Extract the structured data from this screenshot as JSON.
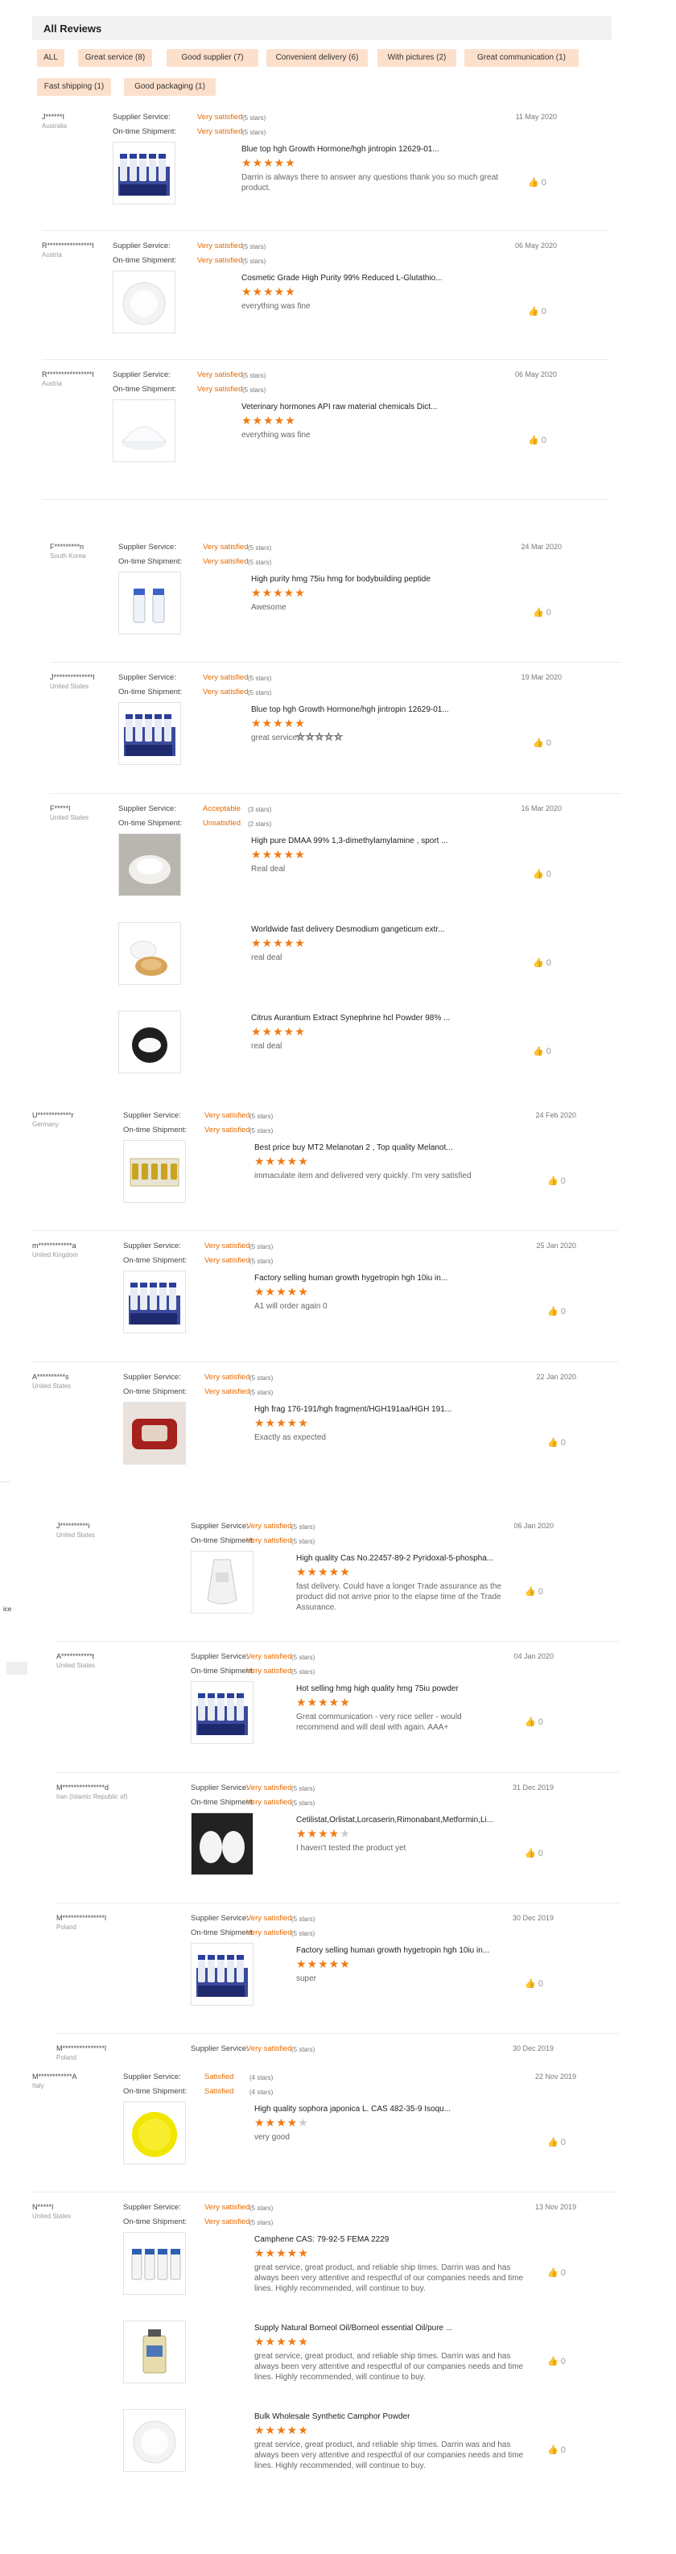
{
  "header": {
    "title": "All Reviews"
  },
  "tabs": [
    {
      "label": "ALL"
    },
    {
      "label": "Great service (8)"
    },
    {
      "label": "Good supplier (7)"
    },
    {
      "label": "Convenient delivery (6)"
    },
    {
      "label": "With pictures (2)"
    },
    {
      "label": "Great communication (1)"
    },
    {
      "label": "Fast shipping (1)"
    },
    {
      "label": "Good packaging (1)"
    }
  ],
  "labels": {
    "supplier_service": "Supplier Service:",
    "on_time_shipment": "On-time Shipment:"
  },
  "sections": [
    {
      "reviews": [
        {
          "name": "J******I",
          "country": "Australia",
          "date": "11 May 2020",
          "supplier": "Very satisfied",
          "supplier_stars": "(5 stars)",
          "shipment": "Very satisfied",
          "shipment_stars": "(5 stars)",
          "products": [
            {
              "title": "Blue top hgh Growth Hormone/hgh jintropin 12629-01...",
              "stars": 5,
              "comment": "Darrin is always there to answer any questions thank you so much great product.",
              "likes": "0",
              "img": "vials-blue"
            }
          ]
        },
        {
          "name": "R****************l",
          "country": "Austria",
          "date": "06 May 2020",
          "supplier": "Very satisfied",
          "supplier_stars": "(5 stars)",
          "shipment": "Very satisfied",
          "shipment_stars": "(5 stars)",
          "products": [
            {
              "title": "Cosmetic Grade High Purity 99% Reduced L-Glutathio...",
              "stars": 5,
              "comment": "everything was fine",
              "likes": "0",
              "img": "powder-dish"
            }
          ]
        },
        {
          "name": "R****************l",
          "country": "Austria",
          "date": "06 May 2020",
          "supplier": "Very satisfied",
          "supplier_stars": "(5 stars)",
          "shipment": "Very satisfied",
          "shipment_stars": "(5 stars)",
          "products": [
            {
              "title": "Veterinary hormones API raw material chemicals Dict...",
              "stars": 5,
              "comment": "everything was fine",
              "likes": "0",
              "img": "powder-pile"
            }
          ]
        }
      ]
    },
    {
      "reviews": [
        {
          "name": "F*********n",
          "country": "South Korea",
          "date": "24 Mar 2020",
          "supplier": "Very satisfied",
          "supplier_stars": "(5 stars)",
          "shipment": "Very satisfied",
          "shipment_stars": "(5 stars)",
          "products": [
            {
              "title": "High purity hmg 75iu hmg for bodybuilding peptide",
              "stars": 5,
              "comment": "Awesome",
              "likes": "0",
              "img": "two-vials"
            }
          ]
        },
        {
          "name": "J**************l",
          "country": "United States",
          "date": "19 Mar 2020",
          "supplier": "Very satisfied",
          "supplier_stars": "(5 stars)",
          "shipment": "Very satisfied",
          "shipment_stars": "(5 stars)",
          "products": [
            {
              "title": "Blue top hgh Growth Hormone/hgh jintropin 12629-01...",
              "stars": 5,
              "comment": "great service",
              "extra_rating": "☆☆☆☆☆",
              "likes": "0",
              "img": "vials-blue"
            }
          ]
        },
        {
          "name": "F*****I",
          "country": "United States",
          "date": "16 Mar 2020",
          "supplier": "Acceptable",
          "supplier_stars": "(3 stars)",
          "shipment": "Unsatisfied",
          "shipment_stars": "(2 stars)",
          "products": [
            {
              "title": "High pure DMAA 99% 1,3-dimethylamylamine , sport ...",
              "stars": 5,
              "comment": "Real deal",
              "likes": "0",
              "img": "powder-photo"
            },
            {
              "title": "Worldwide fast delivery Desmodium gangeticum extr...",
              "stars": 5,
              "comment": "real deal",
              "likes": "0",
              "img": "herb-powder"
            },
            {
              "title": "Citrus Aurantium Extract Synephrine hcl Powder 98% ...",
              "stars": 5,
              "comment": "real deal",
              "likes": "0",
              "img": "powder-dark"
            }
          ]
        }
      ]
    },
    {
      "reviews": [
        {
          "name": "U************r",
          "country": "Germany",
          "date": "24 Feb 2020",
          "supplier": "Very satisfied",
          "supplier_stars": "(5 stars)",
          "shipment": "Very satisfied",
          "shipment_stars": "(5 stars)",
          "products": [
            {
              "title": "Best price buy MT2 Melanotan 2 , Top quality Melanot...",
              "stars": 5,
              "comment": "immaculate item and delivered very quickly. I'm very satisfied",
              "likes": "0",
              "img": "vials-gold"
            }
          ]
        },
        {
          "name": "m************a",
          "country": "United Kingdom",
          "date": "25 Jan 2020",
          "supplier": "Very satisfied",
          "supplier_stars": "(5 stars)",
          "shipment": "Very satisfied",
          "shipment_stars": "(5 stars)",
          "products": [
            {
              "title": "Factory selling human growth hygetropin hgh 10iu in...",
              "stars": 5,
              "comment": "A1 will order again 0",
              "likes": "0",
              "img": "vials-blue"
            }
          ]
        },
        {
          "name": "A**********s",
          "country": "United States",
          "date": "22 Jan 2020",
          "supplier": "Very satisfied",
          "supplier_stars": "(5 stars)",
          "shipment": "Very satisfied",
          "shipment_stars": "(5 stars)",
          "products": [
            {
              "title": "Hgh frag 176-191/hgh fragment/HGH191aa/HGH 191...",
              "stars": 5,
              "comment": "Exactly as expected",
              "likes": "0",
              "img": "red-box"
            }
          ]
        }
      ]
    },
    {
      "reviews": [
        {
          "name": "J**********i",
          "country": "United States",
          "date": "06 Jan 2020",
          "supplier": "Very satisfied",
          "supplier_stars": "(5 stars)",
          "shipment": "Very satisfied",
          "shipment_stars": "(5 stars)",
          "products": [
            {
              "title": "High quality Cas No.22457-89-2 Pyridoxal-5-phospha...",
              "stars": 5,
              "comment": "fast delivery. Could have a longer Trade assurance as the product did not arrive prior to the elapse time of the Trade Assurance.",
              "likes": "0",
              "img": "white-bag"
            }
          ]
        },
        {
          "name": "A***********t",
          "country": "United States",
          "date": "04 Jan 2020",
          "supplier": "Very satisfied",
          "supplier_stars": "(5 stars)",
          "shipment": "Very satisfied",
          "shipment_stars": "(5 stars)",
          "products": [
            {
              "title": "Hot selling hmg high quality hmg 75iu powder",
              "stars": 5,
              "comment": "Great communication - very nice seller - would recommend and will deal with again. AAA+",
              "likes": "0",
              "img": "vials-blue"
            }
          ]
        },
        {
          "name": "M***************d",
          "country": "Iran (Islamic Republic of)",
          "date": "31 Dec 2019",
          "supplier": "Very satisfied",
          "supplier_stars": "(5 stars)",
          "shipment": "Very satisfied",
          "shipment_stars": "(5 stars)",
          "products": [
            {
              "title": "Cetilistat,Orlistat,Lorcaserin,Rimonabant,Metformin,Li...",
              "stars": 4,
              "comment": "I haven't tested the product yet",
              "likes": "0",
              "img": "bags-photo"
            }
          ]
        },
        {
          "name": "M***************l",
          "country": "Poland",
          "date": "30 Dec 2019",
          "supplier": "Very satisfied",
          "supplier_stars": "(5 stars)",
          "shipment": "Very satisfied",
          "shipment_stars": "(5 stars)",
          "products": [
            {
              "title": "Factory selling human growth hygetropin hgh 10iu in...",
              "stars": 5,
              "comment": "super",
              "likes": "0",
              "img": "vials-blue"
            }
          ]
        },
        {
          "name": "M***************l",
          "country": "Poland",
          "date": "30 Dec 2019",
          "supplier": "Very satisfied",
          "supplier_stars": "(5 stars)",
          "shipment": "Very satisfied",
          "shipment_stars": "",
          "products": []
        }
      ]
    },
    {
      "reviews": [
        {
          "name": "M************A",
          "country": "Italy",
          "date": "22 Nov 2019",
          "supplier": "Satisfied",
          "supplier_stars": "(4 stars)",
          "shipment": "Satisfied",
          "shipment_stars": "(4 stars)",
          "products": [
            {
              "title": "High quality sophora japonica L. CAS 482-35-9 Isoqu...",
              "stars": 4,
              "comment": "very good",
              "likes": "0",
              "img": "yellow-dish"
            }
          ]
        },
        {
          "name": "N*****I",
          "country": "United States",
          "date": "13 Nov 2019",
          "supplier": "Very satisfied",
          "supplier_stars": "(5 stars)",
          "shipment": "Very satisfied",
          "shipment_stars": "(5 stars)",
          "products": [
            {
              "title": "Camphene CAS: 79-92-5 FEMA 2229",
              "stars": 5,
              "comment": "great service, great product, and reliable ship times. Darrin was and has always been very attentive and respectful of our companies needs and time lines. Highly recommended, will continue to buy.",
              "likes": "0",
              "img": "bottles"
            },
            {
              "title": "Supply Natural Borneol Oil/Borneol essential Oil/pure ...",
              "stars": 5,
              "comment": "great service, great product, and reliable ship times. Darrin was and has always been very attentive and respectful of our companies needs and time lines. Highly recommended, will continue to buy.",
              "likes": "0",
              "img": "oil-bottle"
            },
            {
              "title": "Bulk Wholesale Synthetic Camphor Powder",
              "stars": 5,
              "comment": "great service, great product, and reliable ship times. Darrin was and has always been very attentive and respectful of our companies needs and time lines. Highly recommended, will continue to buy.",
              "likes": "0",
              "img": "powder-dish"
            }
          ]
        }
      ]
    }
  ],
  "side_fragments": {
    "left_text": "ice"
  }
}
